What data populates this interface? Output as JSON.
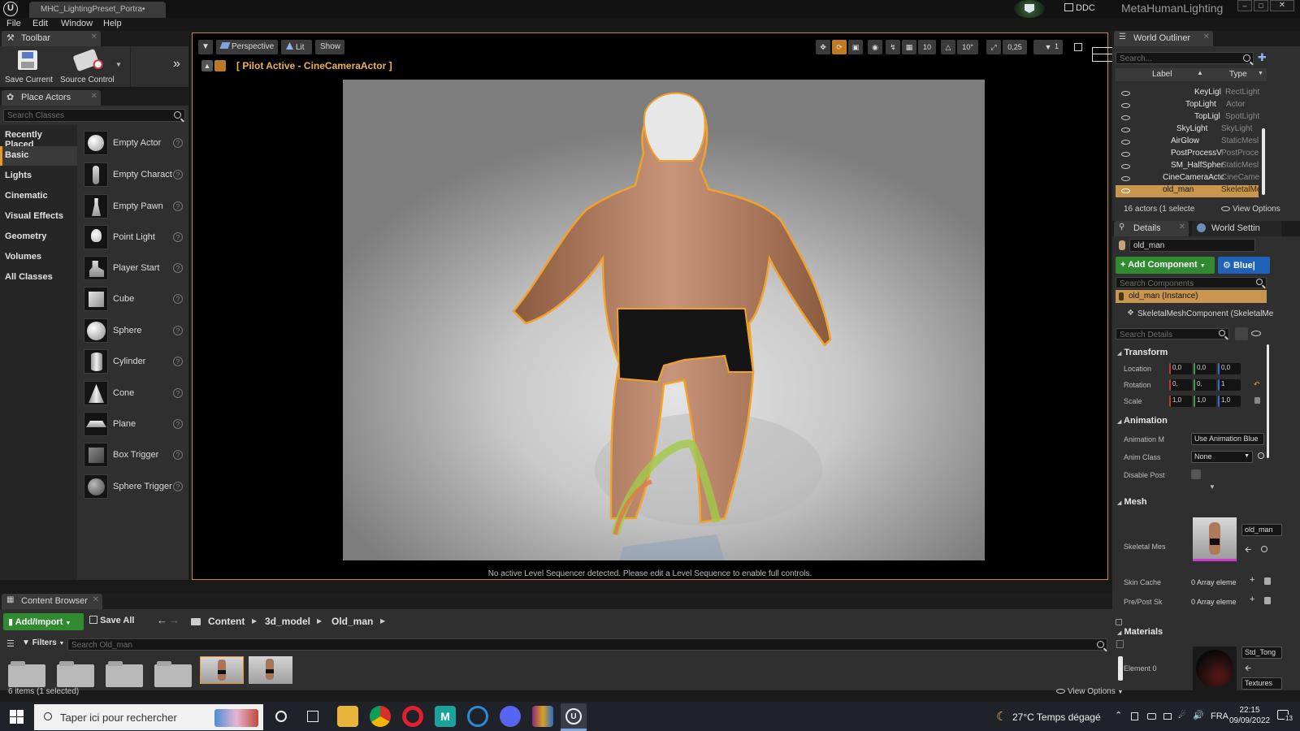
{
  "titlebar": {
    "tab_title": "MHC_LightingPreset_Portra•",
    "ddc_label": "DDC",
    "project_name": "MetaHumanLighting"
  },
  "menu": [
    "File",
    "Edit",
    "Window",
    "Help"
  ],
  "toolbar_panel": {
    "tab_label": "Toolbar",
    "save_label": "Save Current",
    "source_control_label": "Source Control"
  },
  "place_actors": {
    "tab_label": "Place Actors",
    "search_placeholder": "Search Classes",
    "categories": [
      "Recently Placed",
      "Basic",
      "Lights",
      "Cinematic",
      "Visual Effects",
      "Geometry",
      "Volumes",
      "All Classes"
    ],
    "selected_category": "Basic",
    "items": [
      "Empty Actor",
      "Empty Charact",
      "Empty Pawn",
      "Point Light",
      "Player Start",
      "Cube",
      "Sphere",
      "Cylinder",
      "Cone",
      "Plane",
      "Box Trigger",
      "Sphere Trigger"
    ]
  },
  "viewport": {
    "perspective_label": "Perspective",
    "lit_label": "Lit",
    "show_label": "Show",
    "pilot_label": "[ Pilot Active - CineCameraActor ]",
    "grid_value": "10",
    "angle_value": "10°",
    "scale_value": "0,25",
    "speed_value": "1",
    "sequencer_message": "No active Level Sequencer detected. Please edit a Level Sequence to enable full controls."
  },
  "outliner": {
    "tab_label": "World Outliner",
    "search_placeholder": "Search...",
    "col_label": "Label",
    "col_type": "Type",
    "rows": [
      {
        "name": "KeyLigl",
        "type": "RectLight"
      },
      {
        "name": "TopLight",
        "type": "Actor"
      },
      {
        "name": "TopLigl",
        "type": "SpotLight"
      },
      {
        "name": "SkyLight",
        "type": "SkyLight"
      },
      {
        "name": "AirGlow",
        "type": "StaticMesl"
      },
      {
        "name": "PostProcessV",
        "type": "PostProce"
      },
      {
        "name": "SM_HalfSpher",
        "type": "StaticMesl"
      },
      {
        "name": "CineCameraActc",
        "type": "CineCame"
      },
      {
        "name": "old_man",
        "type": "SkeletalMe"
      }
    ],
    "actor_count": "16 actors (1 selecte",
    "view_options": "View Options"
  },
  "details": {
    "tab_label": "Details",
    "world_settings_label": "World Settin",
    "name_value": "old_man",
    "add_component_label": "Add Component",
    "blueprint_label": "Blue|",
    "search_components_placeholder": "Search Components",
    "instance_label": "old_man (Instance)",
    "component_label": "SkeletalMeshComponent (SkeletalMe",
    "search_details_placeholder": "Search Details",
    "transform_label": "Transform",
    "location_label": "Location",
    "rotation_label": "Rotation",
    "scale_label": "Scale",
    "location_values": [
      "0,0",
      "0,0",
      "0,0"
    ],
    "rotation_values": [
      "0,",
      "0,",
      "1"
    ],
    "scale_values": [
      "1,0",
      "1,0",
      "1,0"
    ],
    "animation_label": "Animation",
    "animation_mode_label": "Animation M",
    "animation_mode_value": "Use Animation Blue",
    "anim_class_label": "Anim Class",
    "anim_class_value": "None",
    "disable_post_label": "Disable Post",
    "mesh_label": "Mesh",
    "skeletal_mesh_label": "Skeletal Mes",
    "skeletal_mesh_value": "old_man",
    "skin_cache_label": "Skin Cache",
    "skin_cache_value": "0 Array eleme",
    "pre_post_label": "Pre/Post Sk",
    "pre_post_value": "0 Array eleme",
    "materials_label": "Materials",
    "element0_label": "Element 0",
    "element0_value": "Std_Tong",
    "textures_label": "Textures"
  },
  "content_browser": {
    "tab_label": "Content Browser",
    "add_import_label": "Add/Import",
    "save_all_label": "Save All",
    "breadcrumb": [
      "Content",
      "3d_model",
      "Old_man"
    ],
    "filters_label": "Filters",
    "search_placeholder": "Search Old_man",
    "items_status": "6 items (1 selected)",
    "view_options": "View Options"
  },
  "taskbar": {
    "search_placeholder": "Taper ici pour rechercher",
    "weather": "27°C  Temps dégagé",
    "language": "FRA",
    "time": "22:15",
    "date": "09/09/2022",
    "notification_count": "13"
  },
  "colors": {
    "accent_orange": "#e79a2c",
    "add_green": "#2f8a30",
    "blueprint_blue": "#1f63b8",
    "selection_orange": "#c8964e"
  }
}
